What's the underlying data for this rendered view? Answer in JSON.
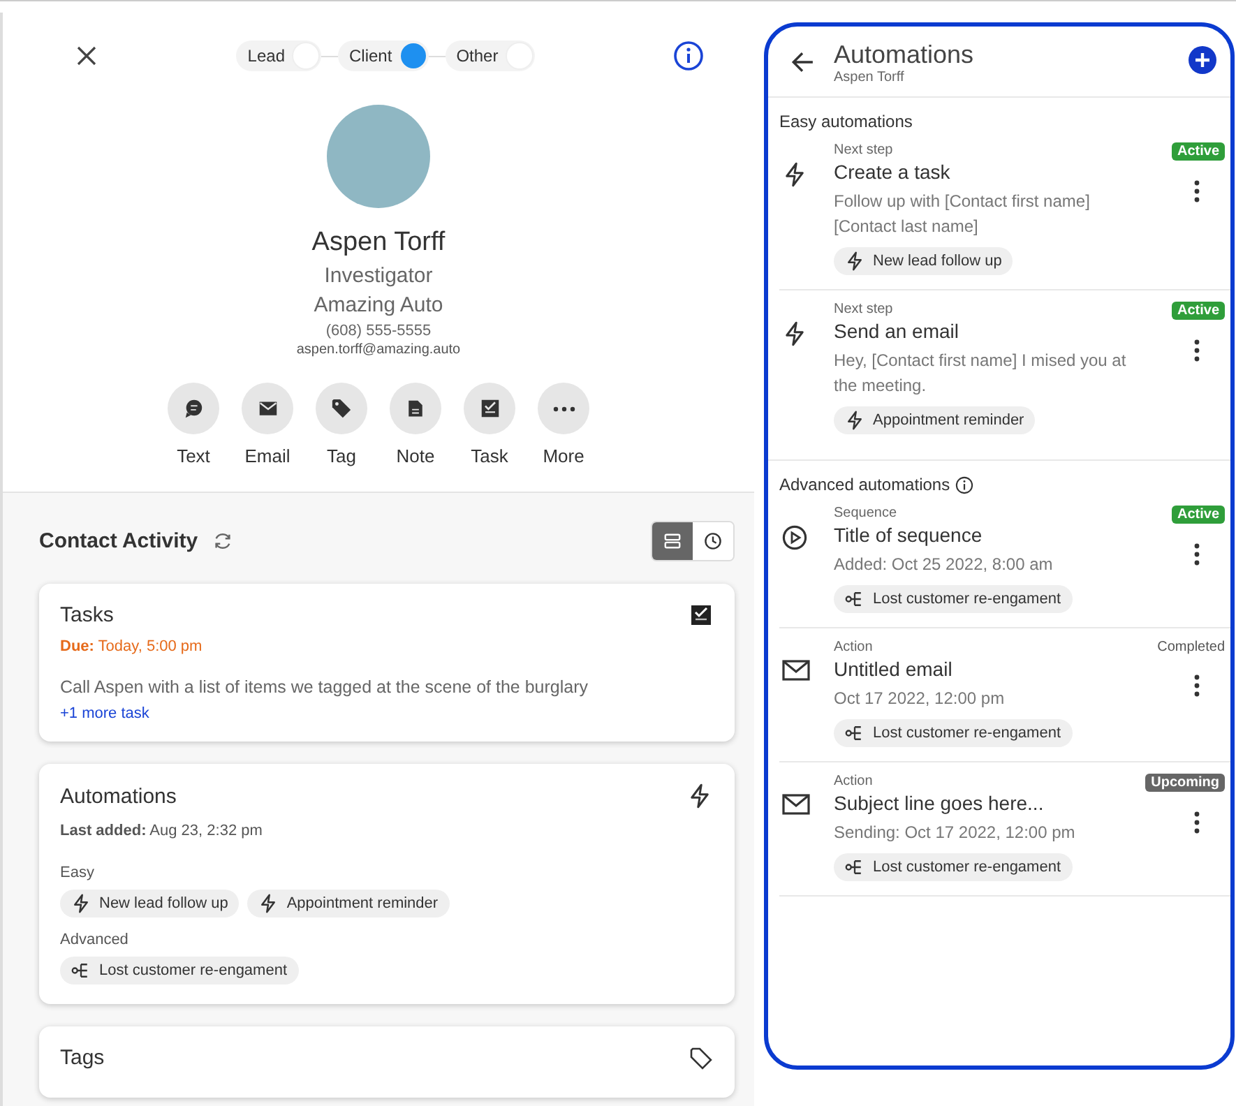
{
  "contact": {
    "types": [
      {
        "label": "Lead",
        "selected": false
      },
      {
        "label": "Client",
        "selected": true
      },
      {
        "label": "Other",
        "selected": false
      }
    ],
    "name": "Aspen Torff",
    "title": "Investigator",
    "company": "Amazing Auto",
    "phone": "(608) 555-5555",
    "email": "aspen.torff@amazing.auto",
    "actions": [
      {
        "kind": "text",
        "label": "Text"
      },
      {
        "kind": "email",
        "label": "Email"
      },
      {
        "kind": "tag",
        "label": "Tag"
      },
      {
        "kind": "note",
        "label": "Note"
      },
      {
        "kind": "task",
        "label": "Task"
      },
      {
        "kind": "more",
        "label": "More"
      }
    ]
  },
  "activity": {
    "title": "Contact Activity",
    "views": [
      {
        "kind": "list",
        "selected": true
      },
      {
        "kind": "clock",
        "selected": false
      }
    ],
    "tasks": {
      "title": "Tasks",
      "due": "**Due:** Today, 5:00 pm",
      "text": "Call Aspen with a list of items we tagged at the scene of the burglary",
      "more": "+1 more task"
    },
    "automations": {
      "title": "Automations",
      "last_added": "**Last added:** Aug 23, 2:32 pm",
      "groups": [
        {
          "label": "Easy",
          "chips": [
            {
              "kind": "bolt",
              "label": "New lead follow up"
            },
            {
              "kind": "bolt",
              "label": "Appointment reminder"
            }
          ]
        },
        {
          "label": "Advanced",
          "chips": [
            {
              "kind": "flow",
              "label": "Lost customer re-engament"
            }
          ]
        }
      ]
    },
    "next_card": {
      "title": "Tags"
    }
  },
  "panel": {
    "title": "Automations",
    "subtitle": "Aspen Torff",
    "sections": [
      {
        "title": "Easy automations",
        "info": false,
        "items": [
          {
            "kind": "bolt",
            "caption": "Next step",
            "title": "Create a task",
            "detail": "Follow up with [Contact first name] [Contact last name]",
            "status": {
              "kind": "active",
              "label": "Active"
            },
            "chip": {
              "kind": "bolt",
              "label": "New lead follow up"
            }
          },
          {
            "kind": "bolt",
            "caption": "Next step",
            "title": "Send an email",
            "detail": "Hey, [Contact first name] I mised you at the meeting.",
            "status": {
              "kind": "active",
              "label": "Active"
            },
            "chip": {
              "kind": "bolt",
              "label": "Appointment reminder"
            }
          }
        ]
      },
      {
        "title": "Advanced automations",
        "info": true,
        "items": [
          {
            "kind": "play",
            "caption": "Sequence",
            "title": "Title of sequence",
            "detail": "Added: Oct 25 2022, 8:00 am",
            "status": {
              "kind": "active",
              "label": "Active"
            },
            "chip": {
              "kind": "flow",
              "label": "Lost customer re-engament"
            }
          },
          {
            "kind": "mail",
            "caption": "Action",
            "title": "Untitled email",
            "detail": "Oct 17 2022, 12:00 pm",
            "status": {
              "kind": "completed",
              "label": "Completed"
            },
            "chip": {
              "kind": "flow",
              "label": "Lost customer re-engament"
            }
          },
          {
            "kind": "mail",
            "caption": "Action",
            "title": "Subject line goes here...",
            "detail": "Sending: Oct 17 2022, 12:00 pm",
            "status": {
              "kind": "upcoming",
              "label": "Upcoming"
            },
            "chip": {
              "kind": "flow",
              "label": "Lost customer re-engament"
            }
          }
        ]
      }
    ]
  }
}
